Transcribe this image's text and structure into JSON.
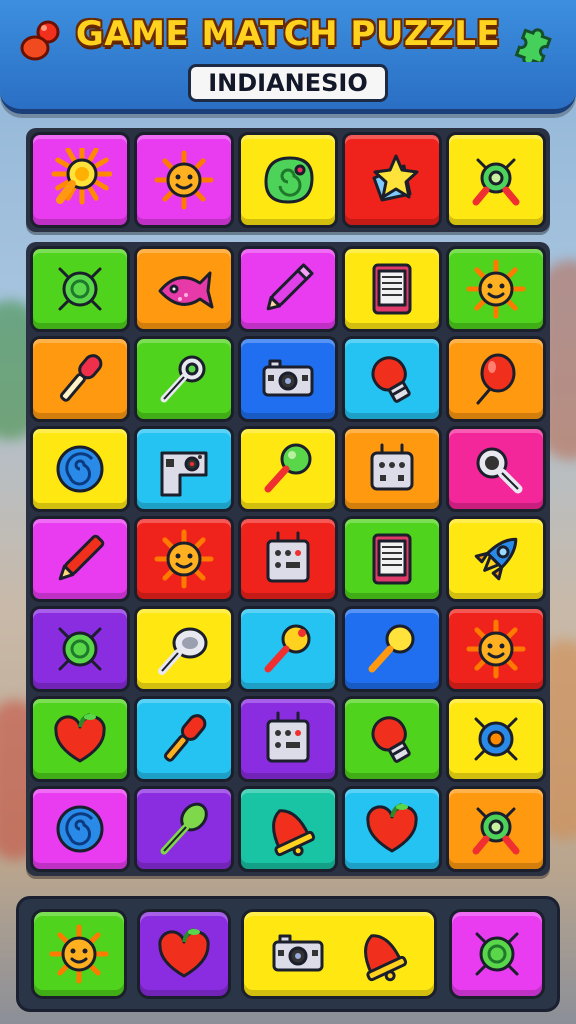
{
  "header": {
    "title": "GAME MATCH PUZZLE",
    "subtitle": "INDIANESIO"
  },
  "colors": {
    "magenta": "#e93cf0",
    "yellow": "#ffe812",
    "red": "#f0221c",
    "green": "#4fd31c",
    "orange": "#ff9a10",
    "blue": "#1f6ff0",
    "cyan": "#25c3f2",
    "pink": "#f4279a",
    "purple": "#8a2ce0",
    "teal": "#18c4a4"
  },
  "top_row": [
    {
      "color": "magenta",
      "icon": "sun-magnifier-icon"
    },
    {
      "color": "magenta",
      "icon": "smiling-sun-icon"
    },
    {
      "color": "yellow",
      "icon": "green-swirl-blob-icon"
    },
    {
      "color": "red",
      "icon": "star-icon"
    },
    {
      "color": "yellow",
      "icon": "gear-magnifier-icon"
    }
  ],
  "grid": [
    [
      {
        "color": "green",
        "icon": "green-gear-icon"
      },
      {
        "color": "orange",
        "icon": "pink-fish-icon"
      },
      {
        "color": "magenta",
        "icon": "pencil-icon"
      },
      {
        "color": "yellow",
        "icon": "tablet-icon"
      },
      {
        "color": "green",
        "icon": "smiling-sun-icon"
      }
    ],
    [
      {
        "color": "orange",
        "icon": "microphone-icon"
      },
      {
        "color": "green",
        "icon": "key-icon"
      },
      {
        "color": "blue",
        "icon": "camera-icon"
      },
      {
        "color": "cyan",
        "icon": "lightbulb-icon"
      },
      {
        "color": "orange",
        "icon": "balloon-icon"
      }
    ],
    [
      {
        "color": "yellow",
        "icon": "swirl-icon"
      },
      {
        "color": "cyan",
        "icon": "gadget-icon"
      },
      {
        "color": "yellow",
        "icon": "lollipop-icon"
      },
      {
        "color": "orange",
        "icon": "robot-box-icon"
      },
      {
        "color": "pink",
        "icon": "magnifier-icon"
      }
    ],
    [
      {
        "color": "magenta",
        "icon": "red-pencil-icon"
      },
      {
        "color": "red",
        "icon": "smiling-sun-icon"
      },
      {
        "color": "red",
        "icon": "control-panel-icon"
      },
      {
        "color": "green",
        "icon": "tablet-icon"
      },
      {
        "color": "yellow",
        "icon": "rocket-icon"
      }
    ],
    [
      {
        "color": "purple",
        "icon": "green-gear-icon"
      },
      {
        "color": "yellow",
        "icon": "pan-icon"
      },
      {
        "color": "cyan",
        "icon": "rattle-icon"
      },
      {
        "color": "blue",
        "icon": "yellow-rattle-icon"
      },
      {
        "color": "red",
        "icon": "smiling-sun-icon"
      }
    ],
    [
      {
        "color": "green",
        "icon": "heart-icon"
      },
      {
        "color": "cyan",
        "icon": "red-microphone-icon"
      },
      {
        "color": "purple",
        "icon": "control-panel-icon"
      },
      {
        "color": "green",
        "icon": "lightbulb-icon"
      },
      {
        "color": "yellow",
        "icon": "blue-gear-icon"
      }
    ],
    [
      {
        "color": "magenta",
        "icon": "swirl-icon"
      },
      {
        "color": "purple",
        "icon": "green-spoon-icon"
      },
      {
        "color": "teal",
        "icon": "bell-icon"
      },
      {
        "color": "cyan",
        "icon": "heart-icon"
      },
      {
        "color": "orange",
        "icon": "gear-magnifier-icon"
      }
    ]
  ],
  "tray": [
    {
      "color": "green",
      "icons": [
        "smiling-sun-icon"
      ]
    },
    {
      "color": "purple",
      "icons": [
        "heart-icon"
      ]
    },
    {
      "color": "yellow",
      "icons": [
        "camera-icon",
        "bell-icon"
      ]
    },
    {
      "color": "magenta",
      "icons": [
        "green-gear-icon"
      ]
    }
  ]
}
